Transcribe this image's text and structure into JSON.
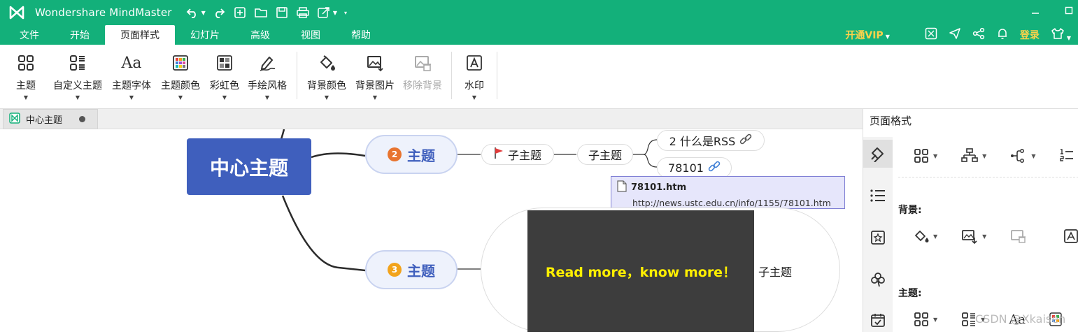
{
  "titlebar": {
    "app_title": "Wondershare MindMaster"
  },
  "menu": {
    "items": [
      "文件",
      "开始",
      "页面样式",
      "幻灯片",
      "高级",
      "视图",
      "帮助"
    ],
    "active_index": 2,
    "vip_label": "开通VIP",
    "login_label": "登录"
  },
  "ribbon": {
    "buttons": [
      {
        "label": "主题",
        "icon": "layout-grid-icon"
      },
      {
        "label": "自定义主题",
        "icon": "custom-theme-icon"
      },
      {
        "label": "主题字体",
        "icon": "font-aa-icon"
      },
      {
        "label": "主题颜色",
        "icon": "color-palette-icon"
      },
      {
        "label": "彩虹色",
        "icon": "rainbow-grid-icon"
      },
      {
        "label": "手绘风格",
        "icon": "pen-icon"
      },
      {
        "label": "背景颜色",
        "icon": "paint-bucket-icon"
      },
      {
        "label": "背景图片",
        "icon": "image-icon"
      },
      {
        "label": "移除背景",
        "icon": "remove-image-icon"
      },
      {
        "label": "水印",
        "icon": "watermark-icon"
      }
    ]
  },
  "doc_tab": {
    "label": "中心主题"
  },
  "panel": {
    "title": "页面格式",
    "section_background": "背景:",
    "section_theme": "主题:"
  },
  "mindmap": {
    "center": "中心主题",
    "topic2": {
      "number": "2",
      "label": "主题"
    },
    "topic3": {
      "number": "3",
      "label": "主题"
    },
    "sub_flag": "子主题",
    "sub_middle": "子主题",
    "leaf_rss": "2 什么是RSS",
    "leaf_link": "78101",
    "sub_right": "子主题",
    "image_text": "Read more，know more！"
  },
  "tooltip": {
    "file": "78101.htm",
    "url": "http://news.ustc.edu.cn/info/1155/78101.htm"
  },
  "watermark": "CSDN @Xkaisen",
  "colors": {
    "brand_green": "#13b07a",
    "center_blue": "#3f5fbd",
    "vip_gold": "#ffd24a",
    "badge_orange": "#e8742f",
    "badge_yellow": "#f2a31b"
  }
}
